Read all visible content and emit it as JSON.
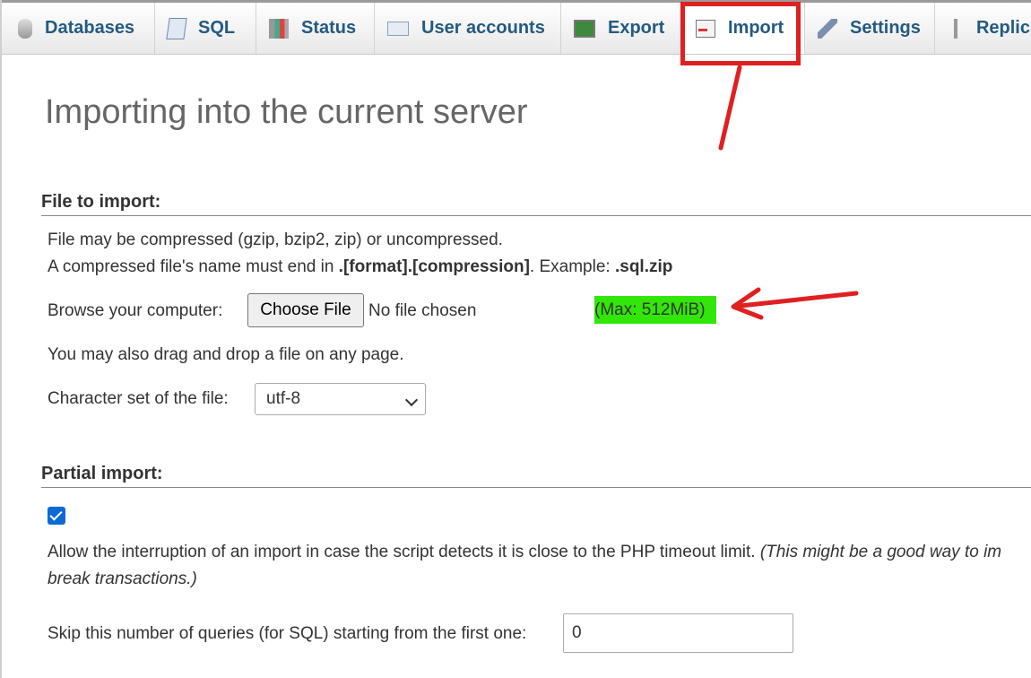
{
  "tabs": [
    {
      "label": "Databases",
      "icon": "database-icon"
    },
    {
      "label": "SQL",
      "icon": "sql-icon"
    },
    {
      "label": "Status",
      "icon": "status-icon"
    },
    {
      "label": "User accounts",
      "icon": "user-accounts-icon"
    },
    {
      "label": "Export",
      "icon": "export-icon"
    },
    {
      "label": "Import",
      "icon": "import-icon",
      "active": true
    },
    {
      "label": "Settings",
      "icon": "settings-icon"
    },
    {
      "label": "Replic",
      "icon": "replication-icon"
    }
  ],
  "page_title": "Importing into the current server",
  "file_section": {
    "heading": "File to import:",
    "compress_note": "File may be compressed (gzip, bzip2, zip) or uncompressed.",
    "name_note_prefix": "A compressed file's name must end in ",
    "name_note_format": ".[format].[compression]",
    "name_note_mid": ". Example: ",
    "name_note_example": ".sql.zip",
    "browse_label": "Browse your computer:",
    "choose_button": "Choose File",
    "no_file": "No file chosen",
    "max_size": "(Max: 512MiB)",
    "drag_note": "You may also drag and drop a file on any page.",
    "charset_label": "Character set of the file:",
    "charset_value": "utf-8"
  },
  "partial_section": {
    "heading": "Partial import:",
    "allow_interrupt_checked": true,
    "allow_text": "Allow the interruption of an import in case the script detects it is close to the PHP timeout limit. ",
    "allow_note_line1": "(This might be a good way to im",
    "allow_note_line2": "break transactions.)",
    "skip_label": "Skip this number of queries (for SQL) starting from the first one:",
    "skip_value": "0"
  },
  "colors": {
    "annotation_red": "#e02020",
    "highlight_green": "#33e60a",
    "tab_text": "#235a81"
  }
}
